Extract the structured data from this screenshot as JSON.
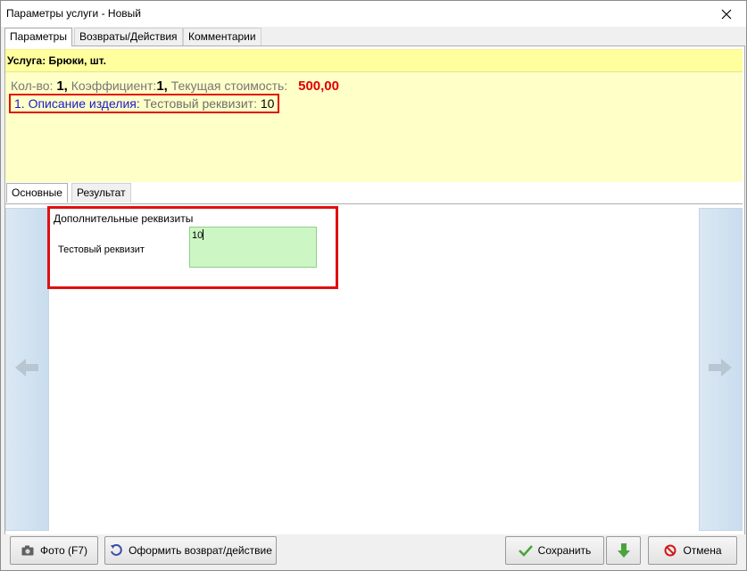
{
  "window": {
    "title": "Параметры услуги - Новый"
  },
  "tabs": [
    {
      "label": "Параметры",
      "active": true
    },
    {
      "label": "Возвраты/Действия",
      "active": false
    },
    {
      "label": "Комментарии",
      "active": false
    }
  ],
  "service": {
    "header": "Услуга: Брюки, шт.",
    "qty_label": "Кол-во:",
    "qty_value": "1,",
    "coef_label": "Коэффициент:",
    "coef_value": "1,",
    "cost_label": "Текущая стоимость:",
    "cost_value": "500,00",
    "description_prefix": "1. Описание изделия:",
    "requisite_text": "Тестовый реквизит:",
    "requisite_value": "10"
  },
  "subtabs": [
    {
      "label": "Основные",
      "active": true
    },
    {
      "label": "Результат",
      "active": false
    }
  ],
  "requisites": {
    "title": "Дополнительные реквизиты",
    "field_label": "Тестовый реквизит",
    "field_value": "10"
  },
  "footer": {
    "photo_button": "Фото (F7)",
    "return_button": "Оформить возврат/действие",
    "save_button": "Сохранить",
    "cancel_button": "Отмена"
  },
  "colors": {
    "info_bg": "#ffffc8",
    "price": "#e00000",
    "highlight_frame": "#e01010",
    "input_bg": "#ccf7c4"
  }
}
